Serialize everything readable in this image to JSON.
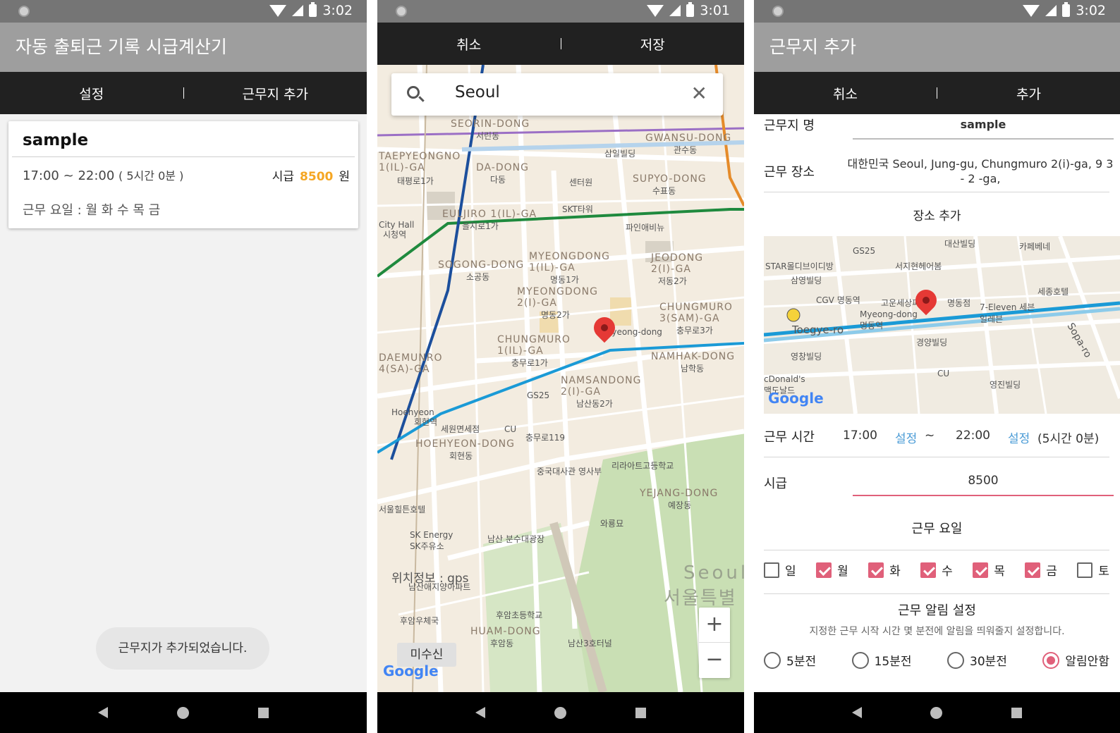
{
  "screen1": {
    "status": {
      "time": "3:02"
    },
    "title": "자동 출퇴근 기록 시급계산기",
    "actions": {
      "left": "설정",
      "right": "근무지 추가"
    },
    "card": {
      "name": "sample",
      "start": "17:00",
      "tilde": "~",
      "end": "22:00",
      "duration": "( 5시간 0분 )",
      "wage_label": "시급",
      "wage_value": "8500",
      "wage_unit": "원",
      "days": "근무 요일 : 월 화 수 목 금"
    },
    "toast": "근무지가 추가되었습니다."
  },
  "screen2": {
    "status": {
      "time": "3:01"
    },
    "actions": {
      "left": "취소",
      "right": "저장"
    },
    "search": {
      "query": "Seoul"
    },
    "map_labels": {
      "seorin": "SEORIN-DONG",
      "seorin_ko": "서린동",
      "gwansu": "GWANSU-DONG",
      "gwansu_ko": "관수동",
      "taepyeong": "TAEPYEONGNO 1(IL)-GA",
      "taepyeong_ko": "태평로1가",
      "dadong": "DA-DONG",
      "dadong_ko": "다동",
      "samil": "삼일빌딩",
      "center": "센터원",
      "supyo": "SUPYO-DONG",
      "supyo_ko": "수표동",
      "skt": "SKT타워",
      "euljiro": "EULJIRO 1(IL)-GA",
      "euljiro_ko": "을지로1가",
      "cityhall": "City Hall",
      "cityhall_ko": "시청역",
      "sogong": "SOGONG-DONG",
      "sogong_ko": "소공동",
      "myeongdong1": "MYEONGDONG 1(IL)-GA",
      "myeongdong1_ko": "명동1가",
      "myeongdong2": "MYEONGDONG 2(I)-GA",
      "myeongdong2_ko": "명동2가",
      "pine": "파인애비뉴",
      "jeodong": "JEODONG 2(I)-GA",
      "jeodong_ko": "저동2가",
      "chungmuro3": "CHUNGMURO 3(SAM)-GA",
      "chungmuro3_ko": "충무로3가",
      "myeong_station": "Myeong-dong",
      "chungmuro1": "CHUNGMURO 1(IL)-GA",
      "chungmuro1_ko": "충무로1가",
      "namhak": "NAMHAK-DONG",
      "namhak_ko": "남학동",
      "namsan": "NAMSANDONG 2(I)-GA",
      "namsan_ko": "남산동2가",
      "daemunro": "DAEMUNRO 4(SA)-GA",
      "hoehyeon": "Hoehyeon",
      "hoehyeon_ko": "회현역",
      "gs25": "GS25",
      "seweon": "세원면세점",
      "cu": "CU",
      "chungmuro119": "충무로119",
      "hoehyeondong": "HOEHYEON-DONG",
      "hoehyeondong_ko": "회현동",
      "embassy": "중국대사관 영사부",
      "liratte": "리라아트고등학교",
      "yejang": "YEJANG-DONG",
      "yejang_ko": "예장동",
      "hilton": "서울힐튼호텔",
      "waryong": "와룡묘",
      "skenergy": "SK Energy SK주유소",
      "fountain": "남산 분수대광장",
      "apt": "남산애지양아파트",
      "post": "후암우체국",
      "school": "후암초등학교",
      "huam": "HUAM-DONG",
      "huam_ko": "후암동",
      "namsan3": "남산3호터널",
      "seoul": "Seoul",
      "seoul_ko": "서울특별"
    },
    "gps": "위치정보 : gps",
    "misusin": "미수신",
    "google": "Google"
  },
  "screen3": {
    "status": {
      "time": "3:02"
    },
    "title": "근무지 추가",
    "actions": {
      "left": "취소",
      "right": "추가"
    },
    "name_label": "근무지 명",
    "name_value": "sample",
    "place_label": "근무 장소",
    "place_value": "대한민국 Seoul, Jung-gu, Chungmuro 2(i)-ga, 9 3 - 2 -ga,",
    "add_place": "장소 추가",
    "mini_map": {
      "daesan": "대산빌딩",
      "cafe": "카페베네",
      "star": "STAR몰디브이디방",
      "gs25": "GS25",
      "seoji": "서지현헤어봄",
      "samyoung": "삼영빌딩",
      "sejong": "세종호텔",
      "cgv": "CGV 명동역",
      "goun": "고운세상피",
      "myeongdong": "명동점",
      "seven": "7-Eleven 세븐일레븐",
      "myeong_station": "Myeong-dong 명동역",
      "toegye": "Toegye-ro",
      "sopa": "Sopa-ro",
      "yeongchang": "영창빌딩",
      "gyeongyang": "경양빌딩",
      "mcd": "cDonald's 맥도날드",
      "cu": "CU",
      "yeongjin": "영진빌딩",
      "google": "Google"
    },
    "time_label": "근무 시간",
    "start": "17:00",
    "set1": "설정",
    "tilde": "~",
    "end": "22:00",
    "set2": "설정",
    "duration": "(5시간 0분)",
    "wage_label": "시급",
    "wage_value": "8500",
    "days_label": "근무 요일",
    "days": [
      {
        "label": "일",
        "checked": false
      },
      {
        "label": "월",
        "checked": true
      },
      {
        "label": "화",
        "checked": true
      },
      {
        "label": "수",
        "checked": true
      },
      {
        "label": "목",
        "checked": true
      },
      {
        "label": "금",
        "checked": true
      },
      {
        "label": "토",
        "checked": false
      }
    ],
    "alarm_label": "근무 알림 설정",
    "alarm_hint": "지정한 근무 시작 시간 몇 분전에 알림을 띄워줄지 설정합니다.",
    "alarm_options": [
      {
        "label": "5분전",
        "selected": false
      },
      {
        "label": "15분전",
        "selected": false
      },
      {
        "label": "30분전",
        "selected": false
      },
      {
        "label": "알림안함",
        "selected": true
      }
    ],
    "colors": {
      "accent": "#e0607a",
      "link": "#4a9bd6",
      "wage": "#f5a623"
    }
  }
}
